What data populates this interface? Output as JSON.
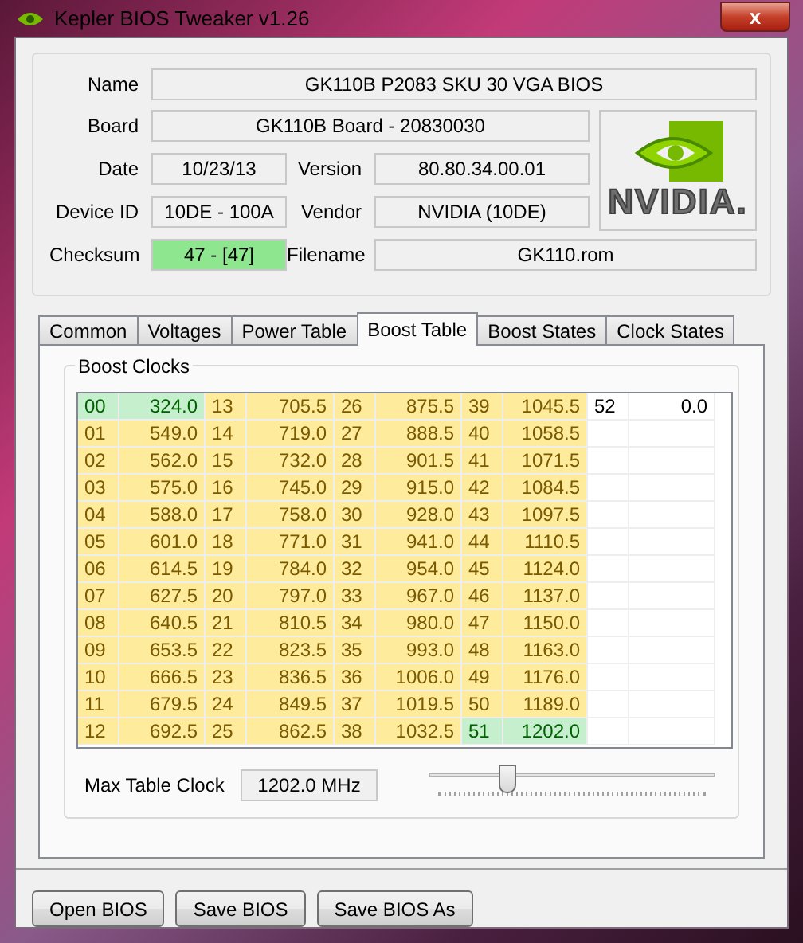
{
  "window": {
    "title": "Kepler BIOS Tweaker v1.26",
    "close": "x"
  },
  "info": {
    "name_label": "Name",
    "name": "GK110B P2083 SKU 30 VGA BIOS",
    "board_label": "Board",
    "board": "GK110B Board - 20830030",
    "date_label": "Date",
    "date": "10/23/13",
    "version_label": "Version",
    "version": "80.80.34.00.01",
    "device_label": "Device ID",
    "device": "10DE - 100A",
    "vendor_label": "Vendor",
    "vendor": "NVIDIA (10DE)",
    "checksum_label": "Checksum",
    "checksum": "47 - [47]",
    "checksum_valid": true,
    "filename_label": "Filename",
    "filename": "GK110.rom",
    "logo_text": "NVIDIA."
  },
  "tabs": [
    {
      "label": "Common",
      "selected": false
    },
    {
      "label": "Voltages",
      "selected": false
    },
    {
      "label": "Power Table",
      "selected": false
    },
    {
      "label": "Boost Table",
      "selected": true
    },
    {
      "label": "Boost States",
      "selected": false
    },
    {
      "label": "Clock States",
      "selected": false
    }
  ],
  "boost_clocks": {
    "title": "Boost Clocks",
    "rows": [
      [
        {
          "id": "00",
          "value": "324.0",
          "kind": "max"
        },
        {
          "id": "13",
          "value": "705.5",
          "kind": "boost"
        },
        {
          "id": "26",
          "value": "875.5",
          "kind": "boost"
        },
        {
          "id": "39",
          "value": "1045.5",
          "kind": "boost"
        },
        {
          "id": "52",
          "value": "0.0",
          "kind": "plain"
        }
      ],
      [
        {
          "id": "01",
          "value": "549.0",
          "kind": "boost"
        },
        {
          "id": "14",
          "value": "719.0",
          "kind": "boost"
        },
        {
          "id": "27",
          "value": "888.5",
          "kind": "boost"
        },
        {
          "id": "40",
          "value": "1058.5",
          "kind": "boost"
        }
      ],
      [
        {
          "id": "02",
          "value": "562.0",
          "kind": "boost"
        },
        {
          "id": "15",
          "value": "732.0",
          "kind": "boost"
        },
        {
          "id": "28",
          "value": "901.5",
          "kind": "boost"
        },
        {
          "id": "41",
          "value": "1071.5",
          "kind": "boost"
        }
      ],
      [
        {
          "id": "03",
          "value": "575.0",
          "kind": "boost"
        },
        {
          "id": "16",
          "value": "745.0",
          "kind": "boost"
        },
        {
          "id": "29",
          "value": "915.0",
          "kind": "boost"
        },
        {
          "id": "42",
          "value": "1084.5",
          "kind": "boost"
        }
      ],
      [
        {
          "id": "04",
          "value": "588.0",
          "kind": "boost"
        },
        {
          "id": "17",
          "value": "758.0",
          "kind": "boost"
        },
        {
          "id": "30",
          "value": "928.0",
          "kind": "boost"
        },
        {
          "id": "43",
          "value": "1097.5",
          "kind": "boost"
        }
      ],
      [
        {
          "id": "05",
          "value": "601.0",
          "kind": "boost"
        },
        {
          "id": "18",
          "value": "771.0",
          "kind": "boost"
        },
        {
          "id": "31",
          "value": "941.0",
          "kind": "boost"
        },
        {
          "id": "44",
          "value": "1110.5",
          "kind": "boost"
        }
      ],
      [
        {
          "id": "06",
          "value": "614.5",
          "kind": "boost"
        },
        {
          "id": "19",
          "value": "784.0",
          "kind": "boost"
        },
        {
          "id": "32",
          "value": "954.0",
          "kind": "boost"
        },
        {
          "id": "45",
          "value": "1124.0",
          "kind": "boost"
        }
      ],
      [
        {
          "id": "07",
          "value": "627.5",
          "kind": "boost"
        },
        {
          "id": "20",
          "value": "797.0",
          "kind": "boost"
        },
        {
          "id": "33",
          "value": "967.0",
          "kind": "boost"
        },
        {
          "id": "46",
          "value": "1137.0",
          "kind": "boost"
        }
      ],
      [
        {
          "id": "08",
          "value": "640.5",
          "kind": "boost"
        },
        {
          "id": "21",
          "value": "810.5",
          "kind": "boost"
        },
        {
          "id": "34",
          "value": "980.0",
          "kind": "boost"
        },
        {
          "id": "47",
          "value": "1150.0",
          "kind": "boost"
        }
      ],
      [
        {
          "id": "09",
          "value": "653.5",
          "kind": "boost"
        },
        {
          "id": "22",
          "value": "823.5",
          "kind": "boost"
        },
        {
          "id": "35",
          "value": "993.0",
          "kind": "boost"
        },
        {
          "id": "48",
          "value": "1163.0",
          "kind": "boost"
        }
      ],
      [
        {
          "id": "10",
          "value": "666.5",
          "kind": "boost"
        },
        {
          "id": "23",
          "value": "836.5",
          "kind": "boost"
        },
        {
          "id": "36",
          "value": "1006.0",
          "kind": "boost"
        },
        {
          "id": "49",
          "value": "1176.0",
          "kind": "boost"
        }
      ],
      [
        {
          "id": "11",
          "value": "679.5",
          "kind": "boost"
        },
        {
          "id": "24",
          "value": "849.5",
          "kind": "boost"
        },
        {
          "id": "37",
          "value": "1019.5",
          "kind": "boost"
        },
        {
          "id": "50",
          "value": "1189.0",
          "kind": "boost"
        }
      ],
      [
        {
          "id": "12",
          "value": "692.5",
          "kind": "boost"
        },
        {
          "id": "25",
          "value": "862.5",
          "kind": "boost"
        },
        {
          "id": "38",
          "value": "1032.5",
          "kind": "boost"
        },
        {
          "id": "51",
          "value": "1202.0",
          "kind": "max"
        }
      ]
    ],
    "max_clock_label": "Max Table Clock",
    "max_clock": "1202.0 MHz",
    "slider": {
      "level": 0.26
    }
  },
  "buttons": [
    "Open BIOS",
    "Save BIOS",
    "Save BIOS As"
  ]
}
